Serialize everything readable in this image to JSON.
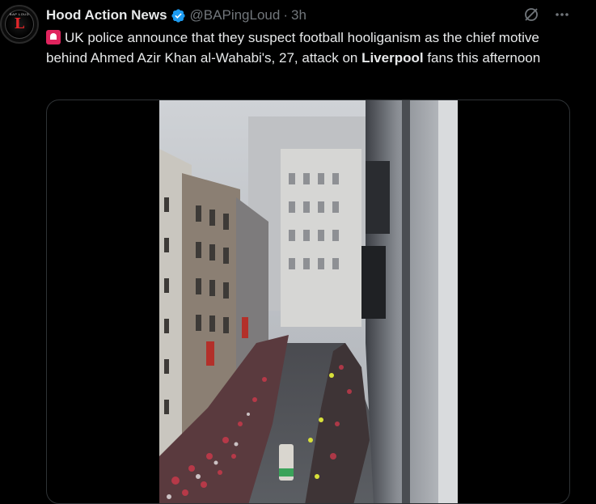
{
  "tweet": {
    "display_name": "Hood Action News",
    "handle": "@BAPingLoud",
    "separator": "·",
    "time": "3h",
    "text_before_bold": "UK police announce that they suspect football hooliganism as the chief motive behind Ahmed Azir Khan al-Wahabi's, 27, attack on ",
    "text_bold": "Liverpool",
    "text_after_bold": " fans this afternoon",
    "text_prefix_icon": "police-siren-emoji"
  },
  "avatar": {
    "letter": "L",
    "ring_text": "BAP LOUD"
  },
  "icons": {
    "verified": "verified-badge-icon",
    "grok": "grok-icon",
    "more": "more-icon"
  },
  "colors": {
    "background": "#000000",
    "text": "#e7e9ea",
    "secondary": "#71767b",
    "verified": "#1d9bf0",
    "siren": "#e0245e",
    "border": "#2f3336"
  },
  "media": {
    "type": "video"
  }
}
